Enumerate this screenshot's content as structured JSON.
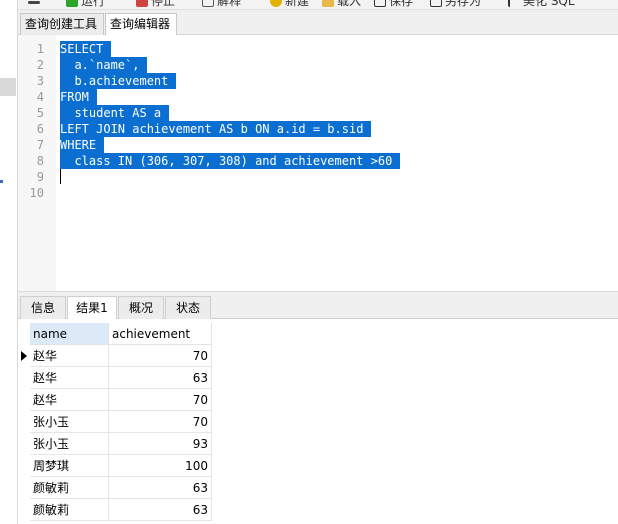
{
  "toolbar": {
    "items": [
      {
        "label": "运行",
        "icon": "play-icon"
      },
      {
        "label": "停止",
        "icon": "stop-icon"
      },
      {
        "label": "解释",
        "icon": "explain-icon"
      },
      {
        "label": "新建",
        "icon": "new-icon"
      },
      {
        "label": "载入",
        "icon": "folder-icon"
      },
      {
        "label": "保存",
        "icon": "save-icon"
      },
      {
        "label": "另存为",
        "icon": "save-as-icon"
      },
      {
        "label": "美化 SQL",
        "icon": "beautify-icon"
      }
    ]
  },
  "tabs": [
    {
      "label": "查询创建工具"
    },
    {
      "label": "查询编辑器"
    }
  ],
  "editor": {
    "lines": [
      {
        "num": "1",
        "text": "SELECT"
      },
      {
        "num": "2",
        "text": "  a.`name`,"
      },
      {
        "num": "3",
        "text": "  b.achievement"
      },
      {
        "num": "4",
        "text": "FROM"
      },
      {
        "num": "5",
        "text": "  student AS a"
      },
      {
        "num": "6",
        "text": "LEFT JOIN achievement AS b ON a.id = b.sid"
      },
      {
        "num": "7",
        "text": "WHERE"
      },
      {
        "num": "8",
        "text": "  class IN (306, 307, 308) and achievement >60"
      },
      {
        "num": "9",
        "text": ""
      },
      {
        "num": "10",
        "text": ""
      }
    ]
  },
  "result_tabs": [
    {
      "label": "信息"
    },
    {
      "label": "结果1"
    },
    {
      "label": "概况"
    },
    {
      "label": "状态"
    }
  ],
  "grid": {
    "columns": [
      "name",
      "achievement"
    ],
    "rows": [
      {
        "name": "赵华",
        "achievement": "70"
      },
      {
        "name": "赵华",
        "achievement": "63"
      },
      {
        "name": "赵华",
        "achievement": "70"
      },
      {
        "name": "张小玉",
        "achievement": "70"
      },
      {
        "name": "张小玉",
        "achievement": "93"
      },
      {
        "name": "周梦琪",
        "achievement": "100"
      },
      {
        "name": "颜敏莉",
        "achievement": "63"
      },
      {
        "name": "颜敏莉",
        "achievement": "63"
      }
    ]
  },
  "colors": {
    "selection": "#0a6fd1",
    "header_highlight": "#dceaf7"
  }
}
